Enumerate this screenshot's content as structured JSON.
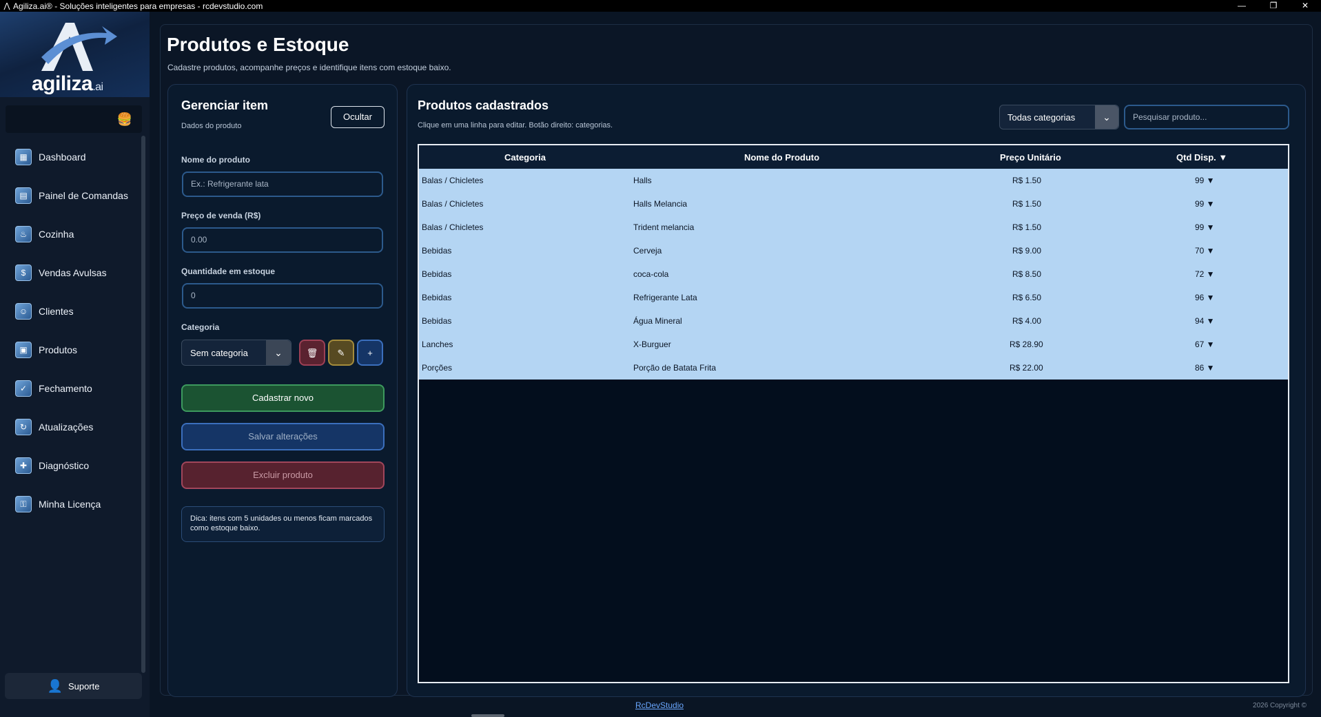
{
  "window": {
    "title": "Agiliza.ai® - Soluções inteligentes para empresas - rcdevstudio.com",
    "minimize": "—",
    "maximize": "❐",
    "close": "✕"
  },
  "sidebar": {
    "brand": "agiliza",
    "brand_suffix": ".ai",
    "menu_icon": "burger-icon",
    "items": [
      {
        "label": "Dashboard",
        "icon": "dashboard-icon"
      },
      {
        "label": "Painel de Comandas",
        "icon": "orders-panel-icon"
      },
      {
        "label": "Cozinha",
        "icon": "kitchen-icon"
      },
      {
        "label": "Vendas Avulsas",
        "icon": "sales-icon"
      },
      {
        "label": "Clientes",
        "icon": "clients-icon"
      },
      {
        "label": "Produtos",
        "icon": "products-icon"
      },
      {
        "label": "Fechamento",
        "icon": "closing-icon"
      },
      {
        "label": "Atualizações",
        "icon": "updates-icon"
      },
      {
        "label": "Diagnóstico",
        "icon": "diagnostics-icon"
      },
      {
        "label": "Minha Licença",
        "icon": "license-icon"
      }
    ],
    "support_label": "Suporte"
  },
  "page": {
    "title": "Produtos e Estoque",
    "subtitle": "Cadastre produtos, acompanhe preços e identifique itens com estoque baixo."
  },
  "manage": {
    "title": "Gerenciar item",
    "subtitle": "Dados do produto",
    "hide_label": "Ocultar",
    "name_label": "Nome do produto",
    "name_placeholder": "Ex.: Refrigerante lata",
    "price_label": "Preço de venda (R$)",
    "price_value": "0.00",
    "qty_label": "Quantidade em estoque",
    "qty_value": "0",
    "category_label": "Categoria",
    "category_value": "Sem categoria",
    "delete_cat_icon": "🗑",
    "edit_cat_icon": "✎",
    "add_cat_icon": "+",
    "btn_new": "Cadastrar novo",
    "btn_save": "Salvar alterações",
    "btn_delete": "Excluir produto",
    "tip": "Dica: itens com 5 unidades ou menos ficam marcados como estoque baixo."
  },
  "products": {
    "title": "Produtos cadastrados",
    "subtitle": "Clique em uma linha para editar. Botão direito: categorias.",
    "filter_value": "Todas categorias",
    "search_placeholder": "Pesquisar produto...",
    "columns": [
      "Categoria",
      "Nome do Produto",
      "Preço Unitário",
      "Qtd Disp. ▼"
    ],
    "rows": [
      {
        "category": "Balas / Chicletes",
        "name": "Halls",
        "price": "R$ 1.50",
        "qty": "99 ▼"
      },
      {
        "category": "Balas / Chicletes",
        "name": "Halls Melancia",
        "price": "R$ 1.50",
        "qty": "99 ▼"
      },
      {
        "category": "Balas / Chicletes",
        "name": "Trident melancia",
        "price": "R$ 1.50",
        "qty": "99 ▼"
      },
      {
        "category": "Bebidas",
        "name": "Cerveja",
        "price": "R$ 9.00",
        "qty": "70 ▼"
      },
      {
        "category": "Bebidas",
        "name": "coca-cola",
        "price": "R$ 8.50",
        "qty": "72 ▼"
      },
      {
        "category": "Bebidas",
        "name": "Refrigerante Lata",
        "price": "R$ 6.50",
        "qty": "96 ▼"
      },
      {
        "category": "Bebidas",
        "name": "Água Mineral",
        "price": "R$ 4.00",
        "qty": "94 ▼"
      },
      {
        "category": "Lanches",
        "name": "X-Burguer",
        "price": "R$ 28.90",
        "qty": "67 ▼"
      },
      {
        "category": "Porções",
        "name": "Porção de Batata Frita",
        "price": "R$ 22.00",
        "qty": "86 ▼"
      }
    ]
  },
  "footer": {
    "link": "RcDevStudio",
    "copyright": "2026 Copyright ©"
  },
  "colors": {
    "background": "#0a1524",
    "row_highlight": "#b4d5f3",
    "accent_blue": "#2c5a8c",
    "new_green": "#1b5332",
    "delete_red": "#57222f"
  }
}
